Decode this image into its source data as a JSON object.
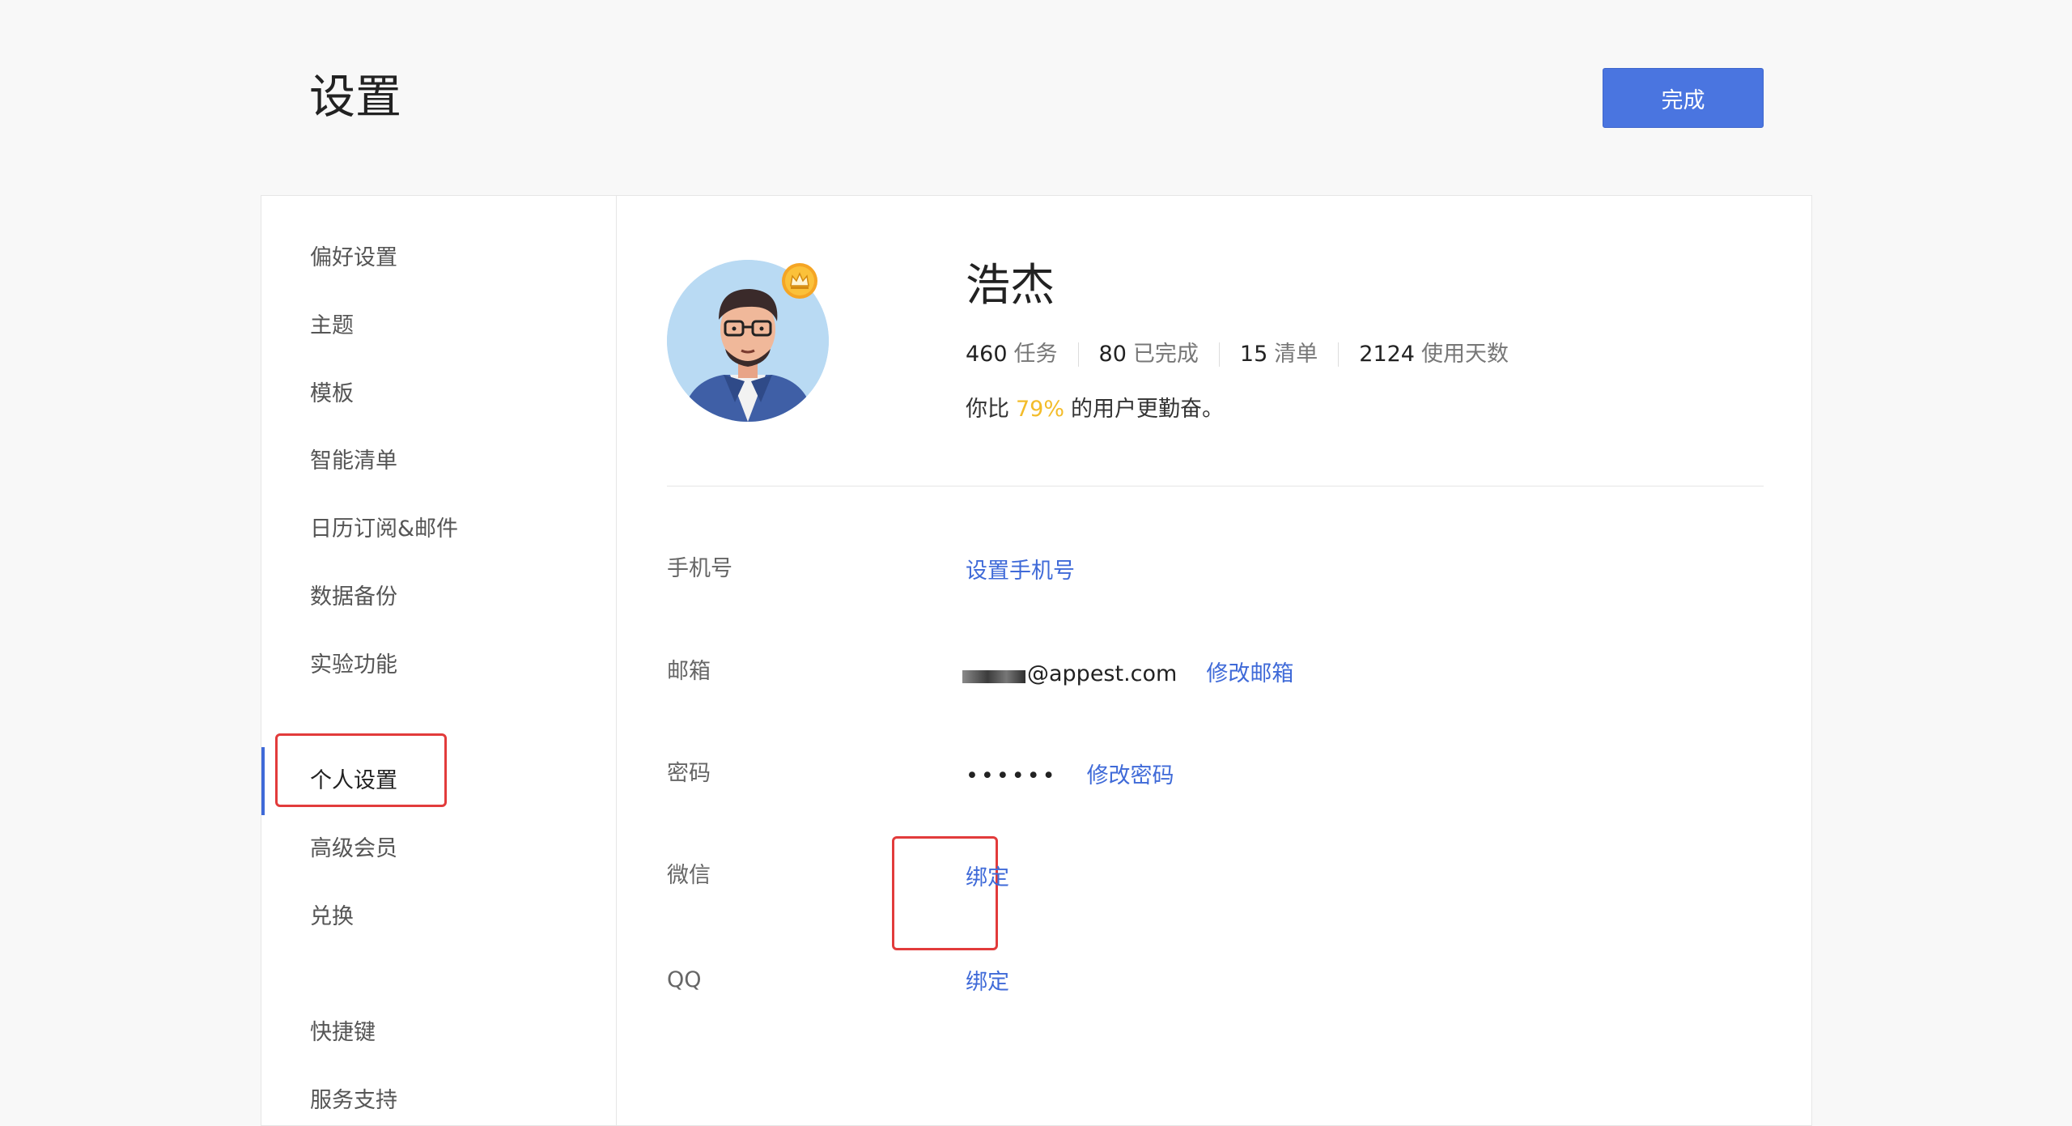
{
  "header": {
    "title": "设置",
    "done_label": "完成"
  },
  "sidebar": {
    "groups": [
      [
        "偏好设置",
        "主题",
        "模板",
        "智能清单",
        "日历订阅&邮件",
        "数据备份",
        "实验功能"
      ],
      [
        "个人设置",
        "高级会员",
        "兑换"
      ],
      [
        "快捷键",
        "服务支持"
      ]
    ],
    "active": "个人设置"
  },
  "profile": {
    "name": "浩杰",
    "stats": [
      {
        "num": "460",
        "label": "任务"
      },
      {
        "num": "80",
        "label": "已完成"
      },
      {
        "num": "15",
        "label": "清单"
      },
      {
        "num": "2124",
        "label": "使用天数"
      }
    ],
    "compare_prefix": "你比",
    "compare_pct": "79%",
    "compare_suffix": "的用户更勤奋。"
  },
  "account": {
    "phone": {
      "label": "手机号",
      "action": "设置手机号"
    },
    "email": {
      "label": "邮箱",
      "value": "@appest.com",
      "action": "修改邮箱"
    },
    "password": {
      "label": "密码",
      "value": "••••••",
      "action": "修改密码"
    },
    "wechat": {
      "label": "微信",
      "action": "绑定"
    },
    "qq": {
      "label": "QQ",
      "action": "绑定"
    }
  },
  "colors": {
    "accent": "#3f6ad8",
    "button": "#4a75e0",
    "highlight_box": "#e23b3b",
    "percent": "#f3bc2a"
  },
  "icons": {
    "avatar": "user-avatar",
    "badge": "crown-icon"
  }
}
